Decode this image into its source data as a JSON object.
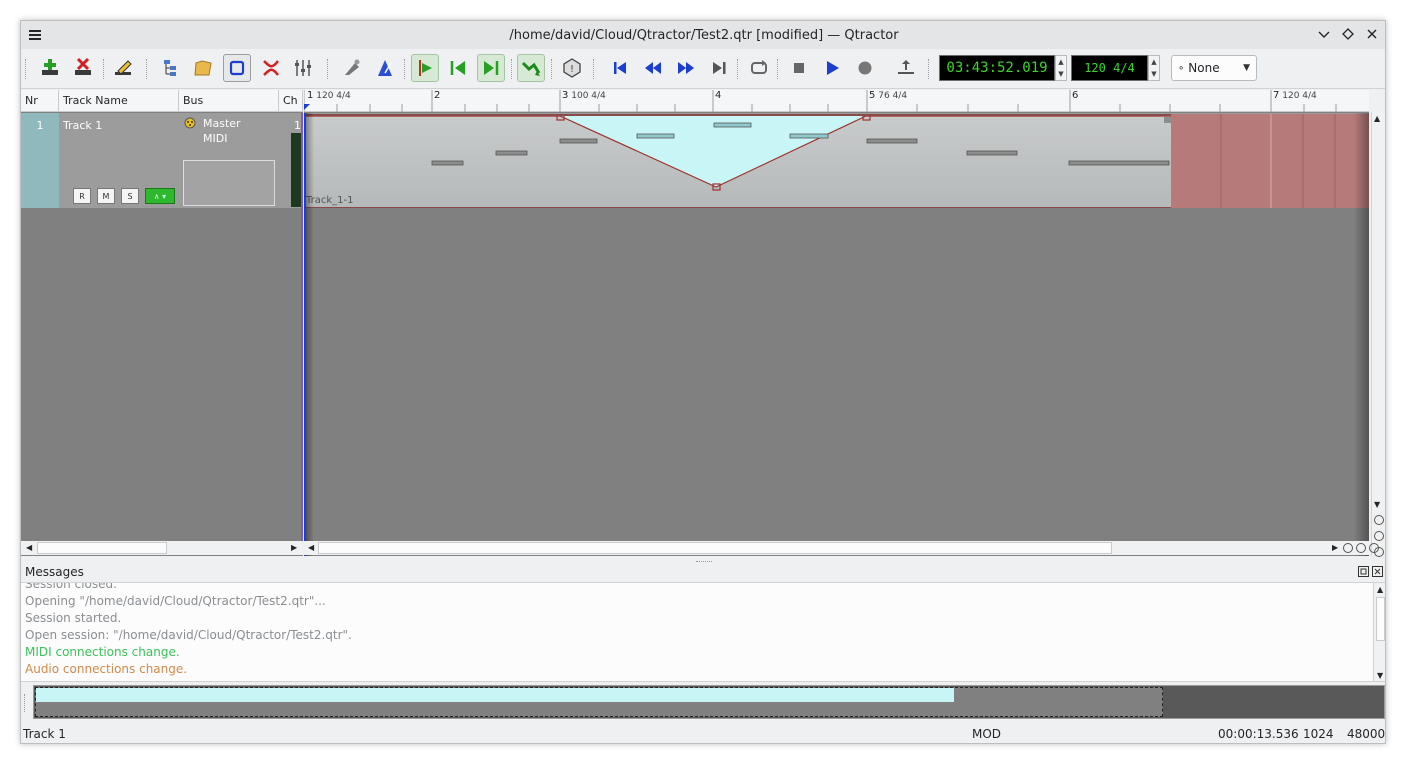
{
  "window": {
    "title": "/home/david/Cloud/Qtractor/Test2.qtr [modified] — Qtractor"
  },
  "toolbar": {
    "time_display": "03:43:52.019",
    "tempo_display": "120 4/4",
    "snap_select": "None",
    "snap_marker": "∘"
  },
  "tracks": {
    "headers": {
      "nr": "Nr",
      "name": "Track Name",
      "bus": "Bus",
      "ch": "Ch"
    },
    "rows": [
      {
        "nr": "1",
        "name": "Track 1",
        "bus_line1": "Master",
        "bus_line2": "MIDI",
        "ch": "1",
        "btn_r": "R",
        "btn_m": "M",
        "btn_s": "S",
        "btn_mon": "∧ ▾"
      }
    ]
  },
  "ruler": {
    "marks": [
      {
        "bar": "1",
        "sig": "120 4/4"
      },
      {
        "bar": "2",
        "sig": ""
      },
      {
        "bar": "3",
        "sig": "100 4/4"
      },
      {
        "bar": "4",
        "sig": ""
      },
      {
        "bar": "5",
        "sig": "76 4/4"
      },
      {
        "bar": "6",
        "sig": ""
      },
      {
        "bar": "7",
        "sig": "120 4/4"
      }
    ]
  },
  "clip": {
    "label": "Track_1-1"
  },
  "messages": {
    "title": "Messages",
    "lines": [
      {
        "text": "Session closed.",
        "kind": "info"
      },
      {
        "text": "Opening \"/home/david/Cloud/Qtractor/Test2.qtr\"...",
        "kind": "info"
      },
      {
        "text": "Session started.",
        "kind": "info"
      },
      {
        "text": "Open session: \"/home/david/Cloud/Qtractor/Test2.qtr\".",
        "kind": "info"
      },
      {
        "text": "MIDI connections change.",
        "kind": "midi"
      },
      {
        "text": "Audio connections change.",
        "kind": "audio"
      }
    ],
    "colors": {
      "info": "#8a8e92",
      "midi": "#3cc15a",
      "audio": "#d08a4a"
    }
  },
  "status": {
    "track": "Track 1",
    "mode": "MOD",
    "time": "00:00:13.536",
    "buffer": "1024",
    "rate": "48000"
  },
  "colors": {
    "lcd_text": "#39d629",
    "track_nr_bg": "#8fb9bc",
    "automation_fill": "#c8f5f6",
    "automation_line": "#a0302a",
    "loop_region": "#b77a7a"
  }
}
